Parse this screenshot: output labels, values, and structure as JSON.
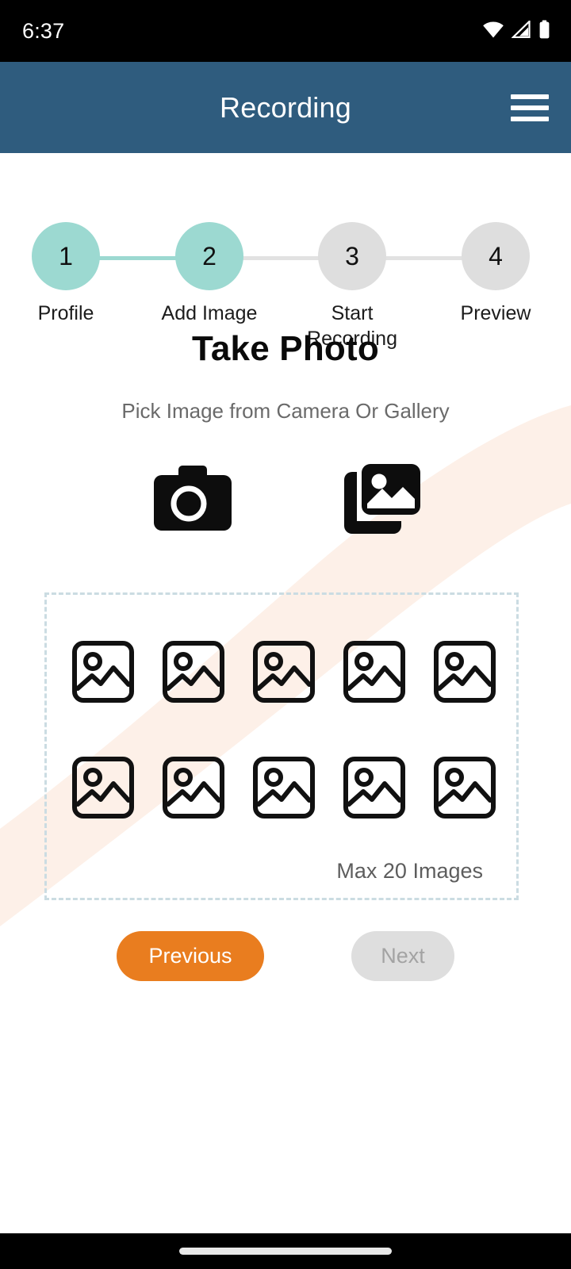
{
  "status_bar": {
    "time": "6:37",
    "icons": [
      "wifi-icon",
      "cellular-signal-icon",
      "battery-icon"
    ]
  },
  "app_bar": {
    "title": "Recording",
    "menu_icon": "hamburger-menu-icon",
    "background_color": "#2F5C7E"
  },
  "stepper": {
    "current_step": 2,
    "active_color": "#9CD9D1",
    "inactive_color": "#DEDEDE",
    "steps": [
      {
        "number": "1",
        "label": "Profile",
        "state": "active"
      },
      {
        "number": "2",
        "label": "Add Image",
        "state": "active"
      },
      {
        "number": "3",
        "label": "Start Recording",
        "state": "inactive"
      },
      {
        "number": "4",
        "label": "Preview",
        "state": "inactive"
      }
    ]
  },
  "main": {
    "title": "Take Photo",
    "subtitle": "Pick Image from Camera Or Gallery",
    "pickers": [
      {
        "name": "camera",
        "icon": "camera-icon"
      },
      {
        "name": "gallery",
        "icon": "gallery-icon"
      }
    ],
    "dropzone": {
      "max_note": "Max 20 Images",
      "placeholder_count": 10,
      "placeholder_icon": "image-placeholder-icon",
      "border_color": "#CBDCE2"
    }
  },
  "actions": {
    "previous_label": "Previous",
    "previous_color": "#E97D1F",
    "next_label": "Next",
    "next_color": "#DEDEDE",
    "next_enabled": false
  },
  "decor": {
    "wave_color": "#FDF0E8"
  }
}
